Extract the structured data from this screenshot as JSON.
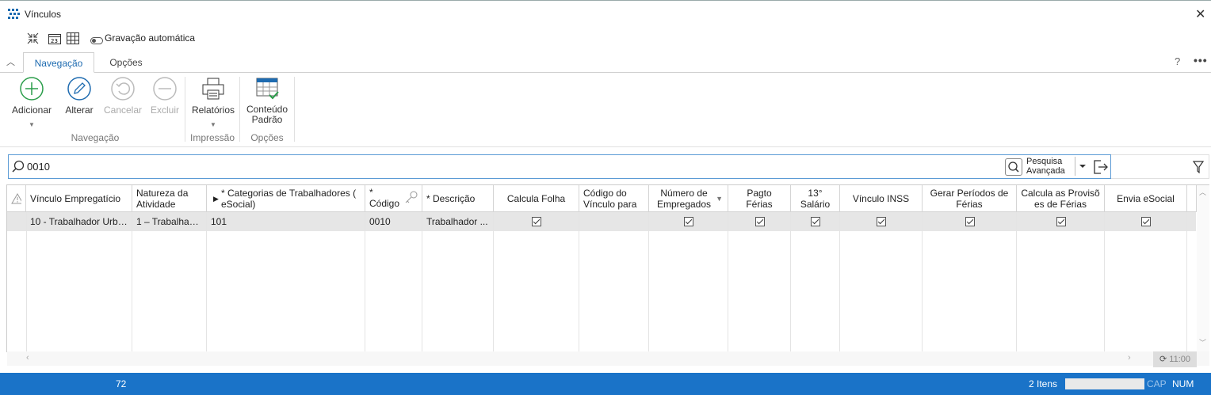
{
  "window": {
    "title": "Vínculos"
  },
  "quick_toolbar": {
    "autosave_label": "Gravação automática"
  },
  "tabs": [
    {
      "label": "Navegação",
      "active": true
    },
    {
      "label": "Opções",
      "active": false
    }
  ],
  "top_right": {
    "help": "?",
    "more": "•••"
  },
  "ribbon": {
    "buttons": [
      {
        "label": "Adicionar",
        "icon": "add-circle-icon",
        "enabled": true
      },
      {
        "label": "Alterar",
        "icon": "pencil-icon",
        "enabled": true
      },
      {
        "label": "Cancelar",
        "icon": "undo-icon",
        "enabled": false
      },
      {
        "label": "Excluir",
        "icon": "minus-circle-icon",
        "enabled": false
      },
      {
        "label": "Relatórios",
        "icon": "printer-icon",
        "enabled": true
      },
      {
        "label": "Conteúdo Padrão",
        "icon": "table-check-icon",
        "enabled": true
      }
    ],
    "groups": [
      "Navegação",
      "Impressão",
      "Opções"
    ]
  },
  "search": {
    "value": "0010",
    "advanced_label": "Pesquisa Avançada"
  },
  "grid": {
    "columns": [
      "Vínculo Empregatício",
      "Natureza da Atividade",
      "* Categorias  de Trabalhadores ( eSocial)",
      "* Código",
      "* Descrição",
      "Calcula Folha",
      "Código do Vínculo para",
      "Número de Empregados",
      "Pagto Férias",
      "13° Salário",
      "Vínculo INSS",
      "Gerar Períodos de Férias",
      "Calcula as Provisõ es de Férias",
      "Envia eSocial"
    ],
    "rows": [
      {
        "vinculo": "10 - Trabalhador Urba...",
        "natureza": "1 – Trabalhado...",
        "categoria": "101",
        "codigo": "0010",
        "descricao": "Trabalhador ...",
        "calcula_folha": true,
        "codigo_vinculo": "",
        "numero_empregados": true,
        "pagto_ferias": true,
        "salario13": true,
        "vinculo_inss": true,
        "gerar_periodos": true,
        "calcula_provisoes": true,
        "envia_esocial": true
      }
    ],
    "refresh_time": "11:00"
  },
  "status": {
    "left_number": "72",
    "items": "2 Itens",
    "cap": "CAP",
    "num": "NUM"
  },
  "colors": {
    "accent": "#1e6bb0",
    "statusbar": "#1a73c8",
    "selected_row": "#e6e6e6"
  }
}
